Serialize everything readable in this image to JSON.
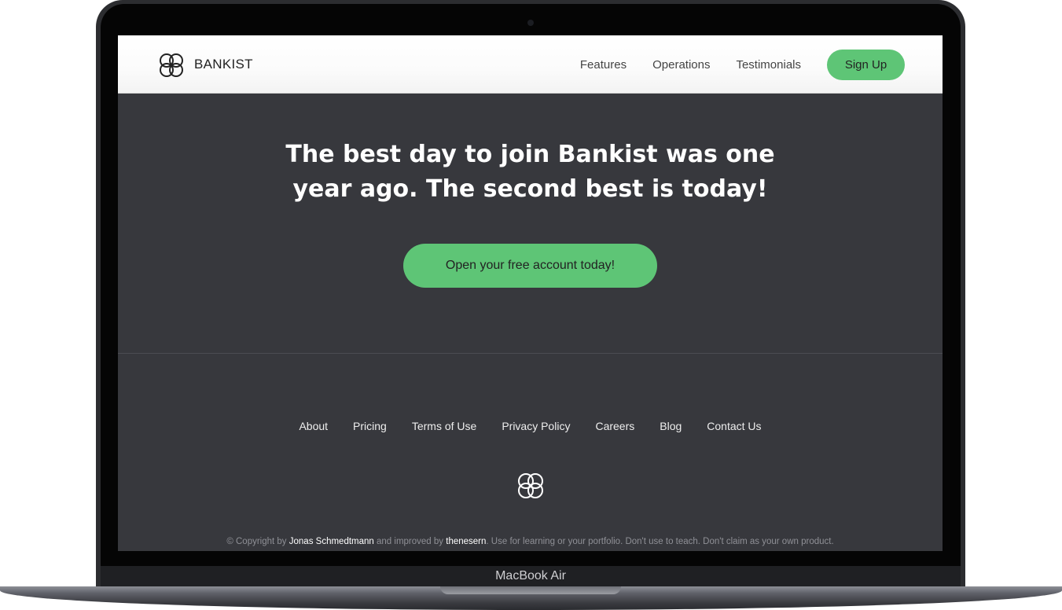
{
  "device": {
    "label": "MacBook Air"
  },
  "nav": {
    "logo_text": "BANKIST",
    "links": [
      "Features",
      "Operations",
      "Testimonials"
    ],
    "cta_label": "Sign Up"
  },
  "hero": {
    "headline_line1": "The best day to join Bankist was one",
    "headline_line2": "year ago. The second best is today!",
    "button_label": "Open your free account today!"
  },
  "footer": {
    "links": [
      "About",
      "Pricing",
      "Terms of Use",
      "Privacy Policy",
      "Careers",
      "Blog",
      "Contact Us"
    ],
    "copyright_prefix": "© Copyright by",
    "author": "Jonas Schmedtmann",
    "middle": "and improved by",
    "improver": "thenesern",
    "suffix": ". Use for learning or your portfolio. Don't use to teach. Don't claim as your own product."
  },
  "colors": {
    "accent": "#5ec576",
    "background": "#37383d",
    "nav_bg": "#ffffff"
  },
  "icons": {
    "logo": "bankist-logo-icon"
  }
}
